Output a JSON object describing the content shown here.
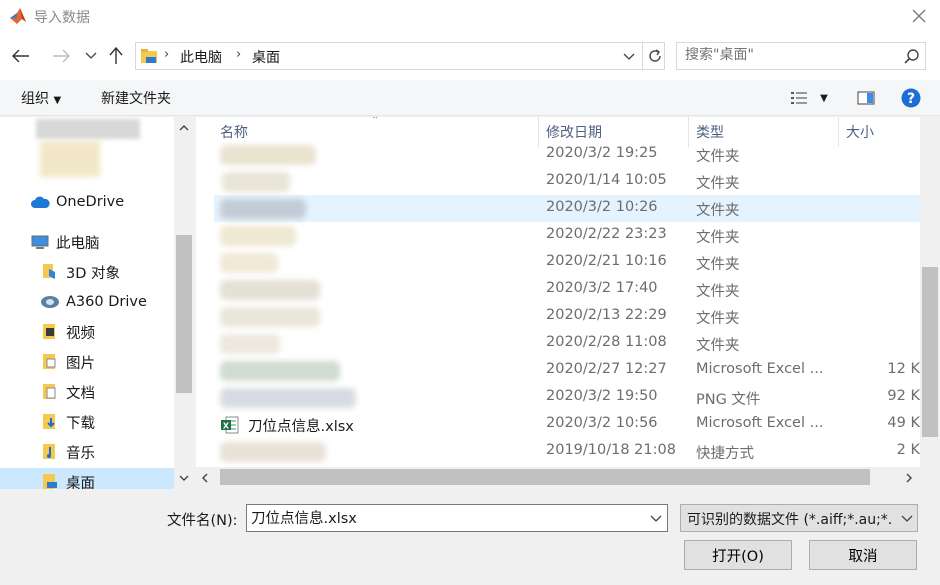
{
  "window": {
    "title": "导入数据"
  },
  "nav": {
    "address_crumbs": [
      "此电脑",
      "桌面"
    ],
    "search_placeholder": "搜索\"桌面\""
  },
  "toolbar": {
    "organize_label": "组织",
    "new_folder_label": "新建文件夹"
  },
  "sidebar": {
    "items": [
      {
        "label": "OneDrive",
        "icon": "cloud-icon"
      },
      {
        "label": "此电脑",
        "icon": "computer-icon"
      },
      {
        "label": "3D 对象",
        "icon": "3d-objects-icon"
      },
      {
        "label": "A360 Drive",
        "icon": "a360-drive-icon"
      },
      {
        "label": "视频",
        "icon": "video-icon"
      },
      {
        "label": "图片",
        "icon": "pictures-icon"
      },
      {
        "label": "文档",
        "icon": "documents-icon"
      },
      {
        "label": "下载",
        "icon": "downloads-icon"
      },
      {
        "label": "音乐",
        "icon": "music-icon"
      },
      {
        "label": "桌面",
        "icon": "desktop-icon"
      }
    ]
  },
  "filelist": {
    "columns": {
      "name": "名称",
      "modified": "修改日期",
      "type": "类型",
      "size": "大小"
    },
    "rows": [
      {
        "name": "",
        "modified": "2020/3/2 19:25",
        "type": "文件夹",
        "size": ""
      },
      {
        "name": "",
        "modified": "2020/1/14 10:05",
        "type": "文件夹",
        "size": ""
      },
      {
        "name": "",
        "modified": "2020/3/2 10:26",
        "type": "文件夹",
        "size": "",
        "selected": true
      },
      {
        "name": "",
        "modified": "2020/2/22 23:23",
        "type": "文件夹",
        "size": ""
      },
      {
        "name": "",
        "modified": "2020/2/21 10:16",
        "type": "文件夹",
        "size": ""
      },
      {
        "name": "",
        "modified": "2020/3/2 17:40",
        "type": "文件夹",
        "size": ""
      },
      {
        "name": "",
        "modified": "2020/2/13 22:29",
        "type": "文件夹",
        "size": ""
      },
      {
        "name": "",
        "modified": "2020/2/28 11:08",
        "type": "文件夹",
        "size": ""
      },
      {
        "name": "",
        "modified": "2020/2/27 12:27",
        "type": "Microsoft Excel ...",
        "size": "12 K"
      },
      {
        "name": "",
        "modified": "2020/3/2 19:50",
        "type": "PNG 文件",
        "size": "92 K"
      },
      {
        "name": "刀位点信息.xlsx",
        "modified": "2020/3/2 10:56",
        "type": "Microsoft Excel ...",
        "size": "49 K"
      },
      {
        "name": "",
        "modified": "2019/10/18 21:08",
        "type": "快捷方式",
        "size": "2 K"
      }
    ]
  },
  "bottom": {
    "filename_label": "文件名(N):",
    "filename_value": "刀位点信息.xlsx",
    "filter_value": "可识别的数据文件 (*.aiff;*.au;*.",
    "open_label": "打开(O)",
    "cancel_label": "取消"
  }
}
